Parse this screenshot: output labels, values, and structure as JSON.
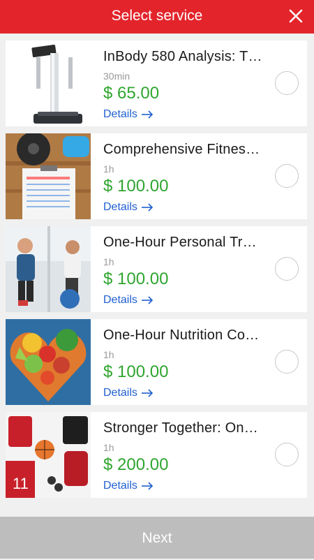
{
  "header": {
    "title": "Select service",
    "close_icon": "close-icon",
    "background_color": "#e3242b"
  },
  "services": [
    {
      "title": "InBody 580 Analysis: T…",
      "duration": "30min",
      "price": "$ 65.00",
      "details_label": "Details",
      "image": "body-composition-scanner"
    },
    {
      "title": "Comprehensive Fitnes…",
      "duration": "1h",
      "price": "$ 100.00",
      "details_label": "Details",
      "image": "weights-and-health-tracker-clipboard"
    },
    {
      "title": "One-Hour Personal Tr…",
      "duration": "1h",
      "price": "$ 100.00",
      "details_label": "Details",
      "image": "personal-trainer-in-gym"
    },
    {
      "title": "One-Hour Nutrition Co…",
      "duration": "1h",
      "price": "$ 100.00",
      "details_label": "Details",
      "image": "fruits-and-vegetables-heart"
    },
    {
      "title": "Stronger Together: On…",
      "duration": "1h",
      "price": "$ 200.00",
      "details_label": "Details",
      "image": "sports-gear-flatlay"
    }
  ],
  "footer": {
    "next_label": "Next"
  },
  "colors": {
    "accent": "#e3242b",
    "price": "#2fa52f",
    "link": "#1f5fd1",
    "footer_disabled": "#bdbdbd"
  }
}
